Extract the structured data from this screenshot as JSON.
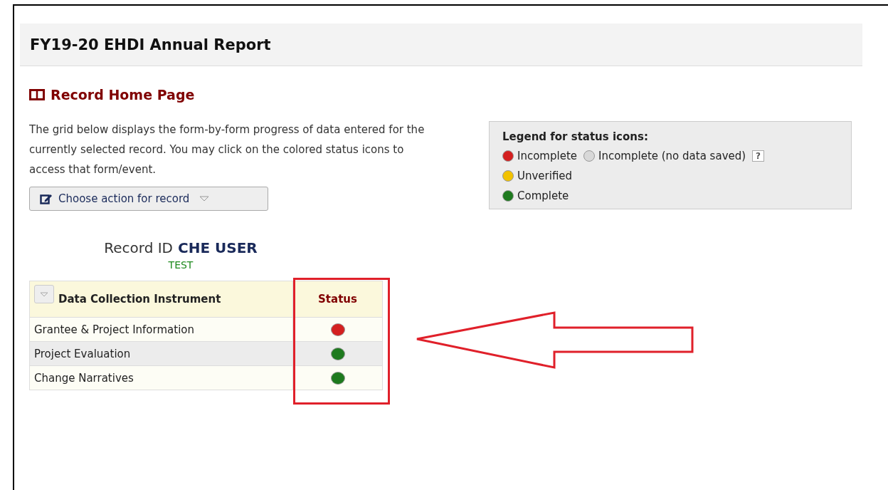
{
  "header": {
    "title": "FY19-20 EHDI Annual Report"
  },
  "page": {
    "title": "Record Home Page",
    "description": "The grid below displays the form-by-form progress of data entered for the currently selected record. You may click on the colored status icons to access that form/event.",
    "action_button": "Choose action for record"
  },
  "legend": {
    "title": "Legend for status icons:",
    "help": "?",
    "items": [
      {
        "label": "Incomplete",
        "color": "#d42020"
      },
      {
        "label": "Incomplete (no data saved)",
        "color": "#d8d8d8"
      },
      {
        "label": "Unverified",
        "color": "#f2c200"
      },
      {
        "label": "Complete",
        "color": "#1e7a1e"
      }
    ]
  },
  "record": {
    "label": "Record ID",
    "id": "CHE USER",
    "subtitle": "TEST"
  },
  "table": {
    "columns": [
      "Data Collection Instrument",
      "Status"
    ],
    "rows": [
      {
        "instrument": "Grantee & Project Information",
        "color": "#d42020"
      },
      {
        "instrument": "Project Evaluation",
        "color": "#1e7a1e"
      },
      {
        "instrument": "Change Narratives",
        "color": "#1e7a1e"
      }
    ]
  }
}
